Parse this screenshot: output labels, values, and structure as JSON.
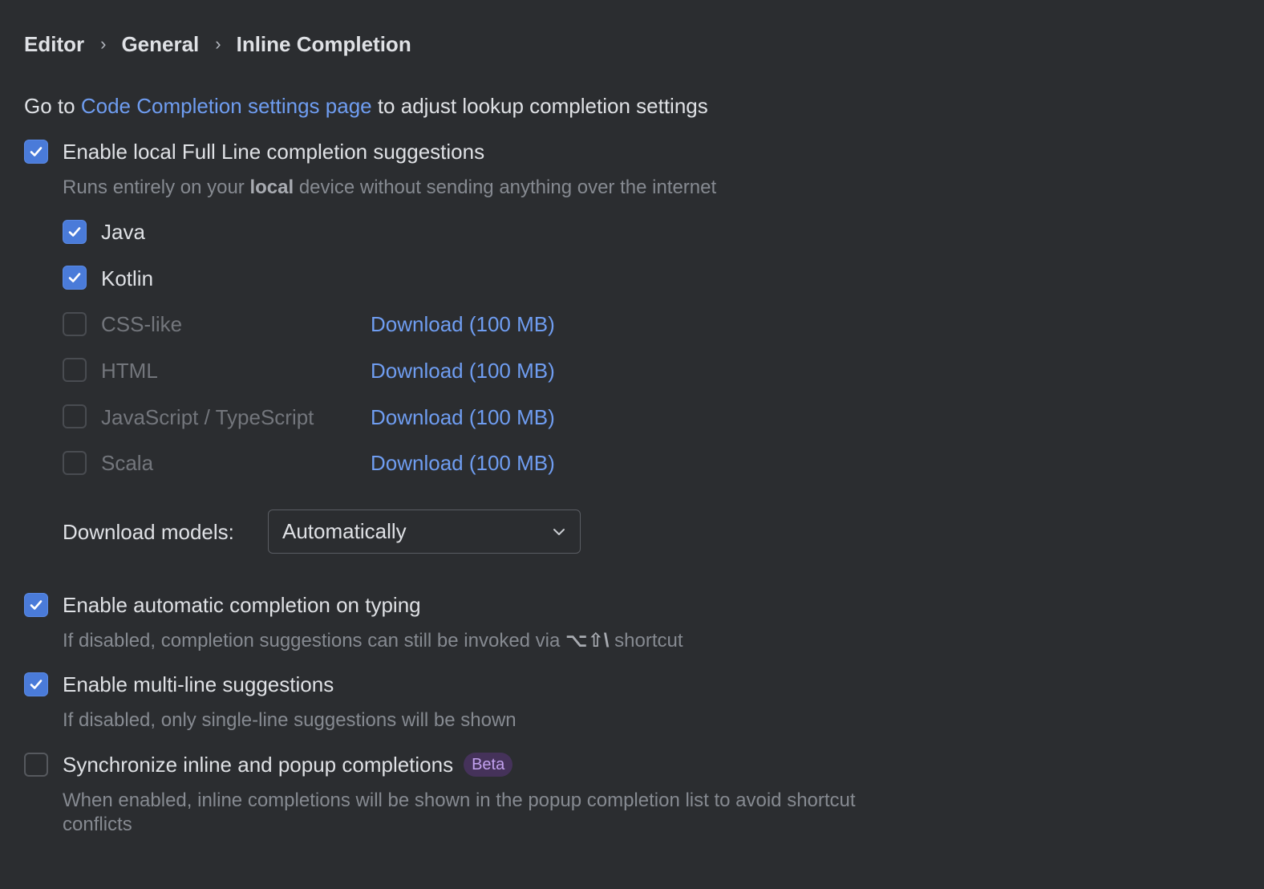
{
  "breadcrumb": [
    "Editor",
    "General",
    "Inline Completion"
  ],
  "intro": {
    "prefix": "Go to ",
    "link": "Code Completion settings page",
    "suffix": " to adjust lookup completion settings"
  },
  "full_line": {
    "label": "Enable local Full Line completion suggestions",
    "checked": true,
    "hint_prefix": "Runs entirely on your ",
    "hint_bold": "local",
    "hint_suffix": " device without sending anything over the internet"
  },
  "languages": [
    {
      "label": "Java",
      "checked": true,
      "enabled": true
    },
    {
      "label": "Kotlin",
      "checked": true,
      "enabled": true
    },
    {
      "label": "CSS-like",
      "checked": false,
      "enabled": false,
      "download": "Download (100 MB)"
    },
    {
      "label": "HTML",
      "checked": false,
      "enabled": false,
      "download": "Download (100 MB)"
    },
    {
      "label": "JavaScript / TypeScript",
      "checked": false,
      "enabled": false,
      "download": "Download (100 MB)"
    },
    {
      "label": "Scala",
      "checked": false,
      "enabled": false,
      "download": "Download (100 MB)"
    }
  ],
  "download_models": {
    "label": "Download models:",
    "value": "Automatically"
  },
  "auto_completion": {
    "label": "Enable automatic completion on typing",
    "checked": true,
    "hint_prefix": "If disabled, completion suggestions can still be invoked via ",
    "shortcut": "⌥⇧\\",
    "hint_suffix": " shortcut"
  },
  "multi_line": {
    "label": "Enable multi-line suggestions",
    "checked": true,
    "hint": "If disabled, only single-line suggestions will be shown"
  },
  "sync": {
    "label": "Synchronize inline and popup completions",
    "checked": false,
    "badge": "Beta",
    "hint_line1": "When enabled, inline completions will be shown in the popup completion list to avoid shortcut",
    "hint_line2": "conflicts"
  },
  "colors": {
    "background": "#2b2d30",
    "accent": "#4a7bd9",
    "link": "#6f9df1",
    "badge_bg": "#45325a",
    "badge_fg": "#c2a1ee"
  },
  "icons": {
    "checkmark": "checkmark-icon",
    "breadcrumb_separator": "chevron-right-icon",
    "dropdown": "chevron-down-icon"
  }
}
